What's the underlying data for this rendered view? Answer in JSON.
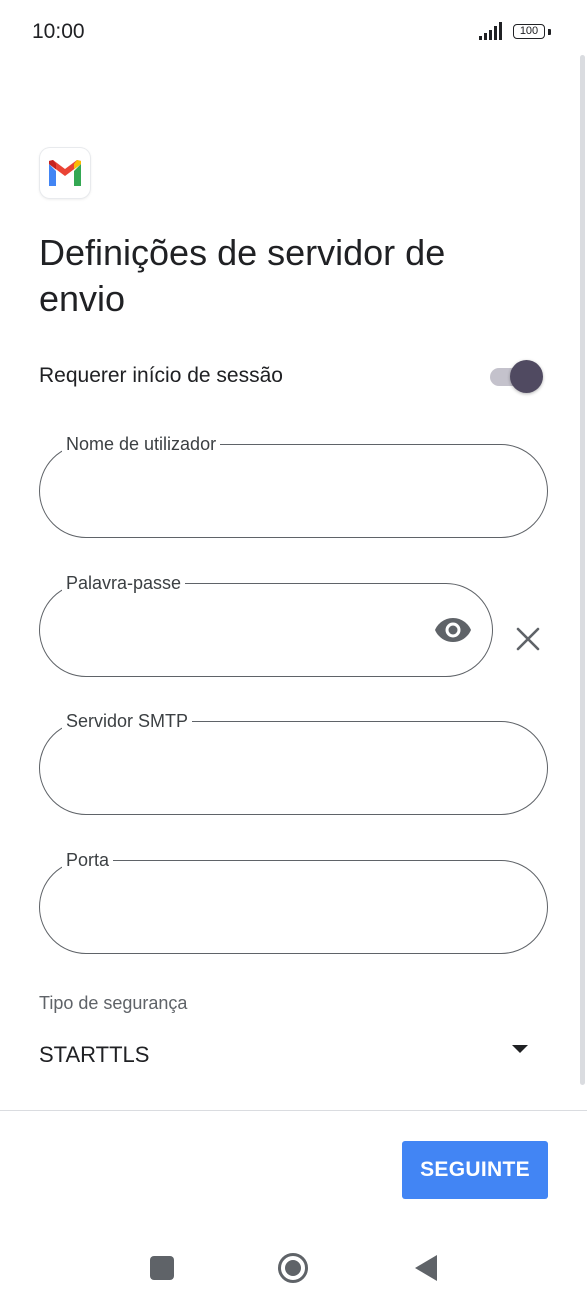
{
  "status_bar": {
    "time": "10:00",
    "battery": "100",
    "icons": [
      "signal-icon",
      "battery-icon"
    ]
  },
  "app": {
    "logo_icon": "gmail-logo",
    "title": "Definições de servidor de envio"
  },
  "sign_in_toggle": {
    "label": "Requerer início de sessão",
    "state": "on",
    "accent_color": "#504a61"
  },
  "fields": {
    "username": {
      "label": "Nome de utilizador",
      "value": ""
    },
    "password": {
      "label": "Palavra-passe",
      "value": "",
      "icons": [
        "eye-icon",
        "close-icon"
      ]
    },
    "smtp_server": {
      "label": "Servidor SMTP",
      "value": ""
    },
    "port": {
      "label": "Porta",
      "value": ""
    }
  },
  "security": {
    "label": "Tipo de segurança",
    "selected": "STARTTLS",
    "icon": "dropdown-arrow-icon"
  },
  "footer": {
    "next_label": "SEGUINTE",
    "button_color": "#4285f4"
  },
  "nav_bar": {
    "icons": [
      "recents-square-icon",
      "home-circle-icon",
      "back-triangle-icon"
    ]
  }
}
